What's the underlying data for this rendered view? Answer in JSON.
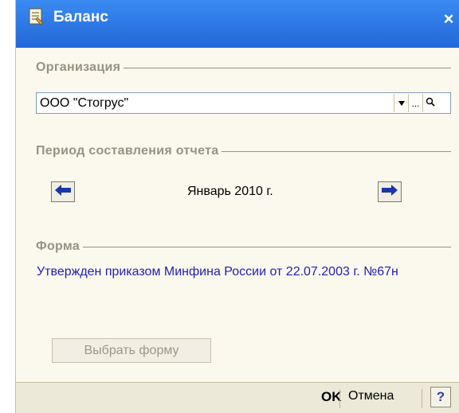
{
  "window": {
    "title": "Баланс",
    "close_label": "×"
  },
  "organization": {
    "label": "Организация",
    "value": "ООО \"Стогрус\"",
    "dropdown_glyph": "▼",
    "select_glyph": "...",
    "open_glyph": "🔍"
  },
  "period": {
    "label": "Период составления отчета",
    "value": "Январь 2010 г."
  },
  "form": {
    "label": "Форма",
    "description": "Утвержден приказом Минфина России от 22.07.2003 г. №67н",
    "select_button": "Выбрать форму"
  },
  "footer": {
    "ok": "OK",
    "cancel": "Отмена",
    "help": "?"
  },
  "colors": {
    "titlebar": "#2a74e6",
    "background": "#FBF8ED",
    "section_header": "#969384",
    "form_text": "#1f1fb3",
    "nav_arrow": "#1a35a8"
  }
}
